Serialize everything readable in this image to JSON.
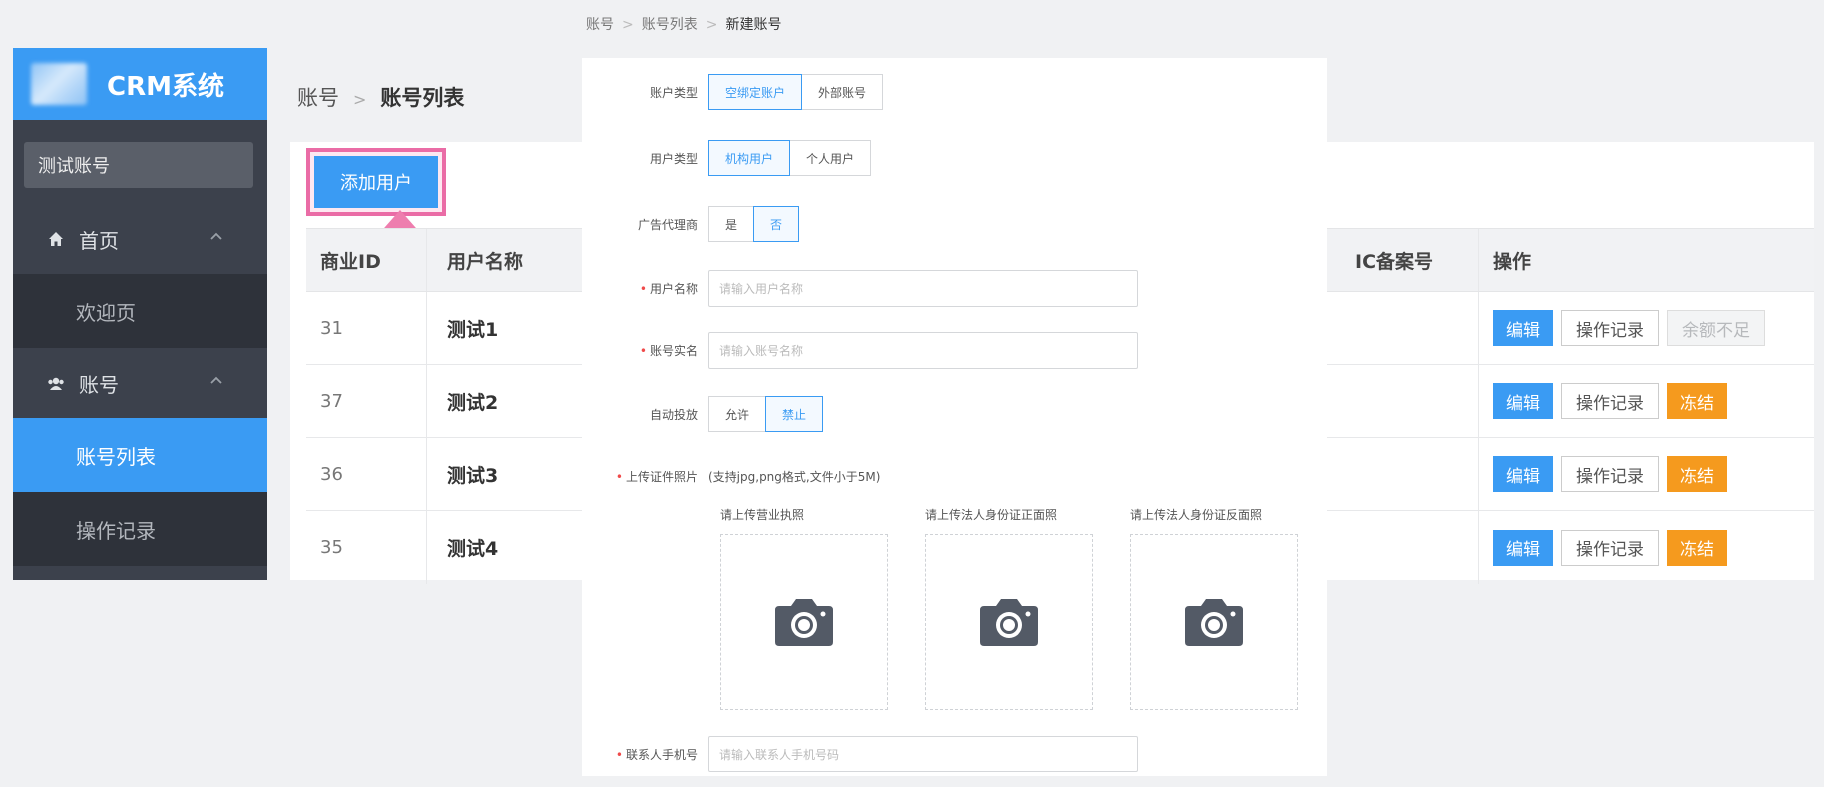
{
  "sidebar": {
    "brand": "CRM系统",
    "user": "测试账号",
    "groups": [
      {
        "label": "首页",
        "subs": [
          "欢迎页"
        ]
      },
      {
        "label": "账号",
        "subs": [
          "账号列表",
          "操作记录"
        ]
      }
    ]
  },
  "breadcrumb_main": {
    "root": "账号",
    "sep": ">",
    "current": "账号列表"
  },
  "list": {
    "add_button": "添加用户",
    "headers": {
      "id": "商业ID",
      "name": "用户名称",
      "ic": "IC备案号",
      "op": "操作"
    },
    "rows": [
      {
        "id": "31",
        "name": "测试1",
        "edit": "编辑",
        "log": "操作记录",
        "action": "余额不足"
      },
      {
        "id": "37",
        "name": "测试2",
        "edit": "编辑",
        "log": "操作记录",
        "action": "冻结"
      },
      {
        "id": "36",
        "name": "测试3",
        "edit": "编辑",
        "log": "操作记录",
        "action": "冻结"
      },
      {
        "id": "35",
        "name": "测试4",
        "edit": "编辑",
        "log": "操作记录",
        "action": "冻结"
      }
    ]
  },
  "breadcrumb_top": {
    "a": "账号",
    "b": "账号列表",
    "c": "新建账号",
    "sep": ">"
  },
  "form": {
    "account_type": {
      "label": "账户类型",
      "options": [
        "空绑定账户",
        "外部账号"
      ]
    },
    "user_type": {
      "label": "用户类型",
      "options": [
        "机构用户",
        "个人用户"
      ]
    },
    "agent": {
      "label": "广告代理商",
      "options": [
        "是",
        "否"
      ]
    },
    "user_name": {
      "label": "用户名称",
      "placeholder": "请输入用户名称"
    },
    "account_name": {
      "label": "账号实名",
      "placeholder": "请输入账号名称"
    },
    "auto_delivery": {
      "label": "自动投放",
      "options": [
        "允许",
        "禁止"
      ]
    },
    "upload": {
      "label": "上传证件照片",
      "hint": "(支持jpg,png格式,文件小于5M)",
      "items": [
        "请上传营业执照",
        "请上传法人身份证正面照",
        "请上传法人身份证反面照"
      ]
    },
    "phone": {
      "label": "联系人手机号",
      "placeholder": "请输入联系人手机号码"
    }
  },
  "colors": {
    "primary": "#3a9bf3",
    "warning": "#f59a1e",
    "sidebar": "#3c414c",
    "highlight": "#ea6ca6"
  }
}
